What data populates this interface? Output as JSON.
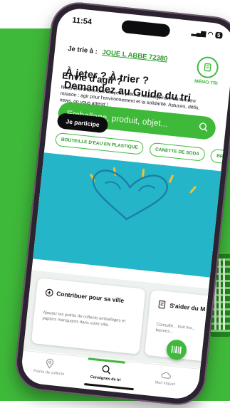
{
  "status": {
    "time": "11:54",
    "battery": "5"
  },
  "location": {
    "label": "Je trie à :",
    "city": "JOUE L ABBE 72380"
  },
  "memo": {
    "label": "MÉMO-TRI"
  },
  "headline": {
    "line1": "À jeter ? À trier ?",
    "line2": "Demandez au Guide du tri"
  },
  "search": {
    "placeholder": "Emballage, produit, objet..."
  },
  "chips": [
    "BOUTEILLE D'EAU EN PLASTIQUE",
    "CANETTE DE SODA",
    "BRIC"
  ],
  "banner": {
    "title": "Envie d'agir ?",
    "text": "Nous cherchons des citoyens prêts à nous rejoindre dans notre mission : agir pour l'environnement et la solidarité. Astuces, défis, news, on vous attend !",
    "button": "Je participe"
  },
  "cards": [
    {
      "title": "Contribuer pour sa ville",
      "text": "Ajoutez les points de collecte emballages et papiers manquants dans votre ville."
    },
    {
      "title": "S'aider du M",
      "text": "Consulte... tout mo... bonnes..."
    }
  ],
  "tabs": [
    {
      "label": "Points de collecte"
    },
    {
      "label": "Consignes de tri"
    },
    {
      "label": "Mon impact"
    }
  ],
  "colors": {
    "brand_green": "#3fb93a",
    "banner_teal": "#24b6c8",
    "accent_yellow": "#f2c230"
  }
}
